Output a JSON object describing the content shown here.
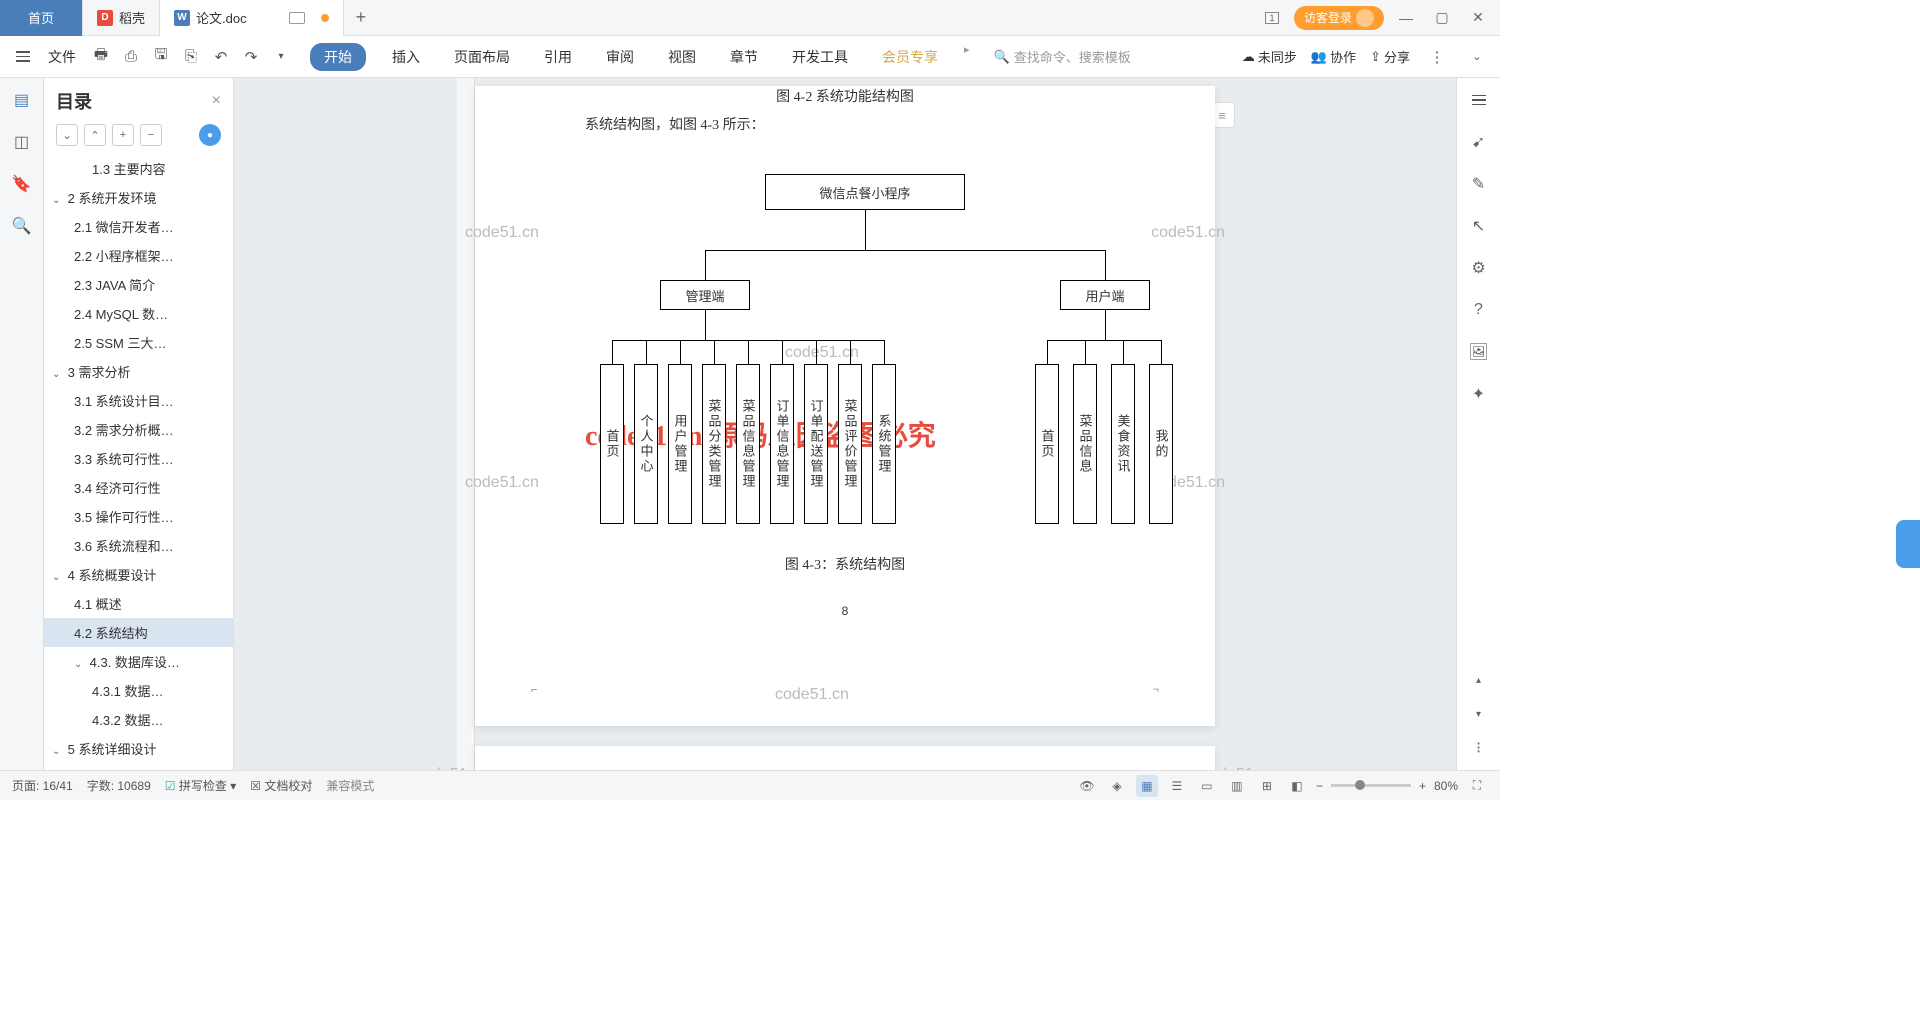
{
  "titlebar": {
    "home": "首页",
    "daohe": "稻壳",
    "doc": "论文.doc",
    "guest_login": "访客登录"
  },
  "toolbar": {
    "file": "文件",
    "menu": {
      "start": "开始",
      "insert": "插入",
      "layout": "页面布局",
      "ref": "引用",
      "review": "审阅",
      "view": "视图",
      "chapter": "章节",
      "dev": "开发工具",
      "vip": "会员专享"
    },
    "search_placeholder": "查找命令、搜索模板",
    "unsync": "未同步",
    "collab": "协作",
    "share": "分享"
  },
  "sidebar": {
    "title": "目录",
    "items": [
      {
        "lvl": 3,
        "txt": "1.3 主要内容"
      },
      {
        "lvl": 1,
        "txt": "2  系统开发环境",
        "exp": true
      },
      {
        "lvl": 2,
        "txt": "2.1 微信开发者…"
      },
      {
        "lvl": 2,
        "txt": "2.2 小程序框架…"
      },
      {
        "lvl": 2,
        "txt": "2.3 JAVA 简介"
      },
      {
        "lvl": 2,
        "txt": "2.4 MySQL 数…"
      },
      {
        "lvl": 2,
        "txt": "2.5 SSM 三大…"
      },
      {
        "lvl": 1,
        "txt": "3  需求分析",
        "exp": true
      },
      {
        "lvl": 2,
        "txt": "3.1 系统设计目…"
      },
      {
        "lvl": 2,
        "txt": "3.2 需求分析概…"
      },
      {
        "lvl": 2,
        "txt": "3.3 系统可行性…"
      },
      {
        "lvl": 2,
        "txt": "3.4 经济可行性"
      },
      {
        "lvl": 2,
        "txt": "3.5 操作可行性…"
      },
      {
        "lvl": 2,
        "txt": "3.6 系统流程和…"
      },
      {
        "lvl": 1,
        "txt": "4 系统概要设计",
        "exp": true
      },
      {
        "lvl": 2,
        "txt": "4.1 概述"
      },
      {
        "lvl": 2,
        "txt": "4.2  系统结构",
        "sel": true
      },
      {
        "lvl": 2,
        "txt": "4.3. 数据库设…",
        "exp": true
      },
      {
        "lvl": 3,
        "txt": "4.3.1 数据…"
      },
      {
        "lvl": 3,
        "txt": "4.3.2 数据…"
      },
      {
        "lvl": 1,
        "txt": "5 系统详细设计",
        "exp": true
      },
      {
        "lvl": 2,
        "txt": "5.1 用户端功能…"
      },
      {
        "lvl": 2,
        "txt": "5.2 管理员端功…"
      }
    ]
  },
  "doc": {
    "caption_42": "图 4-2 系统功能结构图",
    "text_43": "系统结构图，如图 4-3 所示：",
    "caption_43": "图 4-3：系统结构图",
    "page_num": "8",
    "diagram": {
      "root": "微信点餐小程序",
      "admin": "管理端",
      "user": "用户端",
      "admin_children": [
        "首页",
        "个人中心",
        "用户管理",
        "菜品分类管理",
        "菜品信息管理",
        "订单信息管理",
        "订单配送管理",
        "菜品评价管理",
        "系统管理"
      ],
      "user_children": [
        "首页",
        "菜品信息",
        "美食资讯",
        "我的"
      ]
    },
    "big_watermark": "code51.cn-源码乐园盗图必究",
    "wm": "code51.cn"
  },
  "statusbar": {
    "page": "页面: 16/41",
    "words": "字数: 10689",
    "spell": "拼写检查",
    "proof": "文档校对",
    "compat": "兼容模式",
    "zoom": "80%"
  }
}
